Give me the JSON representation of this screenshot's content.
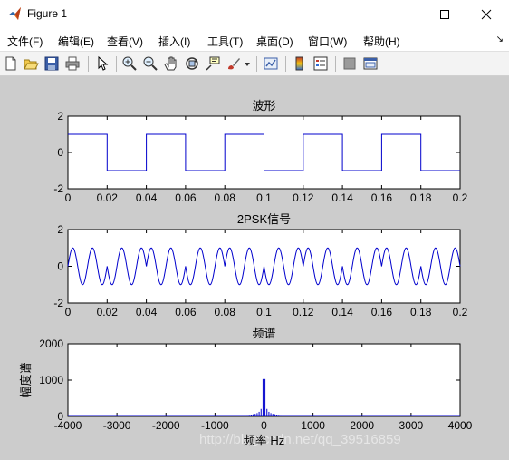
{
  "window": {
    "title": "Figure 1",
    "minimize_glyph": "—",
    "maximize_glyph": "☐",
    "close_glyph": "✕"
  },
  "menu": {
    "items": [
      "文件(F)",
      "编辑(E)",
      "查看(V)",
      "插入(I)",
      "工具(T)",
      "桌面(D)",
      "窗口(W)",
      "帮助(H)"
    ],
    "overflow_glyph": "↘"
  },
  "toolbar": {
    "icons": [
      "new-figure-icon",
      "open-file-icon",
      "save-icon",
      "print-icon",
      "edit-plot-arrow-icon",
      "zoom-in-icon",
      "zoom-out-icon",
      "pan-hand-icon",
      "rotate-3d-icon",
      "data-cursor-icon",
      "brush-icon",
      "link-plot-icon",
      "insert-colorbar-icon",
      "insert-legend-icon",
      "hide-plot-tools-icon",
      "show-plot-tools-icon"
    ]
  },
  "watermark": "http://blog.csdn.net/qq_39516859",
  "colors": {
    "line": "#0000cc",
    "figure_background": "#cccccc",
    "axes_background": "#ffffff"
  },
  "chart_data": [
    {
      "type": "line",
      "title": "波形",
      "xlabel": "",
      "ylabel": "",
      "xlim": [
        0,
        0.2
      ],
      "ylim": [
        -2,
        2
      ],
      "xticks": [
        "0",
        "0.02",
        "0.04",
        "0.06",
        "0.08",
        "0.1",
        "0.12",
        "0.14",
        "0.16",
        "0.18",
        "0.2"
      ],
      "yticks": [
        "-2",
        "0",
        "2"
      ],
      "grid": false,
      "series": [
        {
          "x": [
            0,
            0.02,
            0.02,
            0.04,
            0.04,
            0.06,
            0.06,
            0.08,
            0.08,
            0.1,
            0.1,
            0.12,
            0.12,
            0.14,
            0.14,
            0.16,
            0.16,
            0.18,
            0.18,
            0.2
          ],
          "y": [
            1,
            1,
            -1,
            -1,
            1,
            1,
            -1,
            -1,
            1,
            1,
            -1,
            -1,
            1,
            1,
            -1,
            -1,
            1,
            1,
            -1,
            -1
          ]
        }
      ]
    },
    {
      "type": "line",
      "title": "2PSK信号",
      "xlabel": "",
      "ylabel": "",
      "xlim": [
        0,
        0.2
      ],
      "ylim": [
        -2,
        2
      ],
      "xticks": [
        "0",
        "0.02",
        "0.04",
        "0.06",
        "0.08",
        "0.1",
        "0.12",
        "0.14",
        "0.16",
        "0.18",
        "0.2"
      ],
      "yticks": [
        "-2",
        "0",
        "2"
      ],
      "grid": false,
      "carrier_hz": 100,
      "amplitude": 1,
      "bits": [
        1,
        0,
        1,
        0,
        1,
        0,
        1,
        0,
        1,
        0
      ],
      "bit_duration": 0.02
    },
    {
      "type": "line",
      "title": "频谱",
      "xlabel": "频率 Hz",
      "ylabel": "幅度谱",
      "xlim": [
        -4000,
        4000
      ],
      "ylim": [
        0,
        2000
      ],
      "xticks": [
        "-4000",
        "-3000",
        "-2000",
        "-1000",
        "0",
        "1000",
        "2000",
        "3000",
        "4000"
      ],
      "yticks": [
        "0",
        "1000",
        "2000"
      ],
      "grid": false,
      "spectrum": {
        "center_hz": 0,
        "peak_offsets_hz": [
          -20,
          20
        ],
        "peak_value": 1030,
        "sideline_spacing_hz": 40,
        "sideline_extent_hz": 1100
      }
    }
  ]
}
